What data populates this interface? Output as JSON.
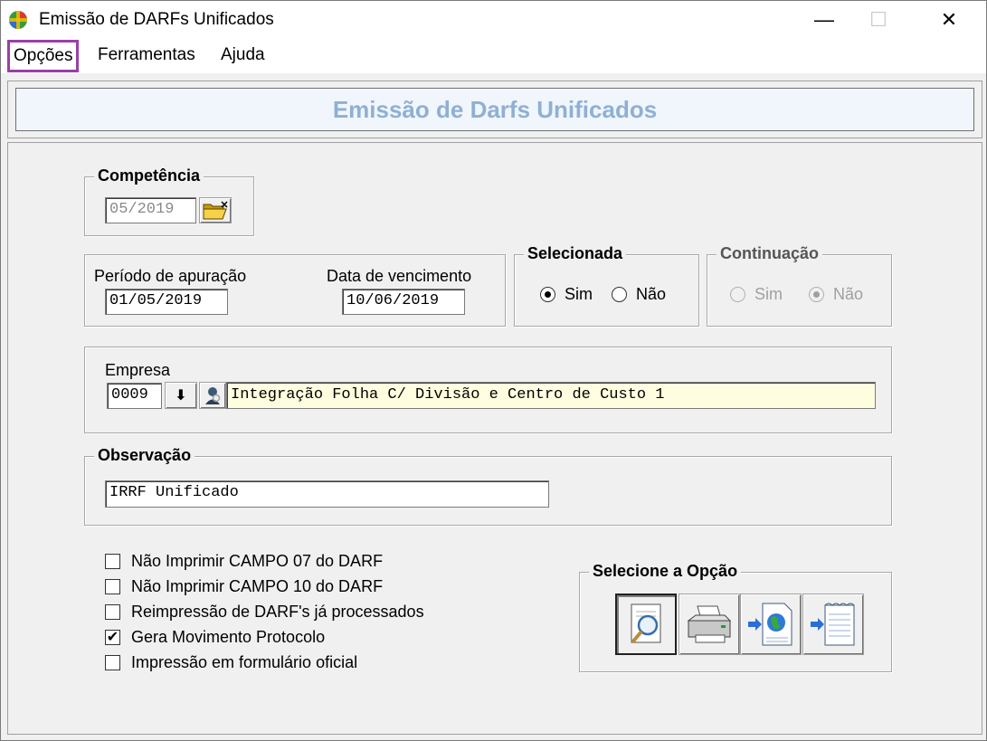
{
  "window": {
    "title": "Emissão de DARFs Unificados",
    "controls": {
      "minimize": "—",
      "maximize": "☐",
      "close": "✕"
    }
  },
  "menu": [
    "Opções",
    "Ferramentas",
    "Ajuda"
  ],
  "header": {
    "title": "Emissão de Darfs Unificados",
    "color": "#8fb0d4"
  },
  "competencia": {
    "label": "Competência",
    "value": "05/2019"
  },
  "periodo": {
    "apuracao_label": "Período de apuração",
    "apuracao_value": "01/05/2019",
    "vencimento_label": "Data de vencimento",
    "vencimento_value": "10/06/2019"
  },
  "selecionada": {
    "label": "Selecionada",
    "sim": "Sim",
    "nao": "Não",
    "selected": "Sim"
  },
  "continuacao": {
    "label": "Continuação",
    "sim": "Sim",
    "nao": "Não",
    "selected": "Não"
  },
  "empresa": {
    "label": "Empresa",
    "code": "0009",
    "name": "Integração Folha C/ Divisão e Centro de Custo 1",
    "download_icon": "⬇"
  },
  "observacao": {
    "label": "Observação",
    "value": "IRRF Unificado"
  },
  "checks": [
    {
      "label": "Não Imprimir CAMPO 07 do DARF",
      "checked": false
    },
    {
      "label": "Não Imprimir CAMPO 10 do DARF",
      "checked": false
    },
    {
      "label": "Reimpressão de DARF's já processados",
      "checked": false
    },
    {
      "label": "Gera Movimento Protocolo",
      "checked": true,
      "mark": "✔"
    },
    {
      "label": "Impressão em formulário oficial",
      "checked": false
    }
  ],
  "opcoes": {
    "label": "Selecione a Opção",
    "buttons": [
      "preview-icon",
      "printer-icon",
      "export-web-icon",
      "export-file-icon"
    ]
  }
}
